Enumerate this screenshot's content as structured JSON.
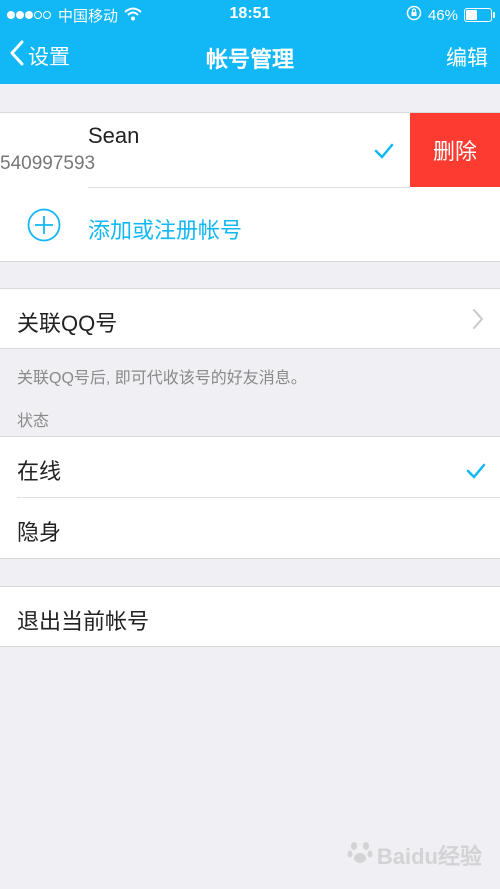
{
  "status_bar": {
    "carrier": "中国移动",
    "time": "18:51",
    "battery": "46%",
    "battery_level": 0.46
  },
  "nav": {
    "back_label": "设置",
    "title": "帐号管理",
    "edit_label": "编辑"
  },
  "account": {
    "name": "Sean",
    "id": "540997593",
    "delete_label": "删除"
  },
  "add_account_label": "添加或注册帐号",
  "linked_qq": {
    "label": "关联QQ号",
    "hint": "关联QQ号后, 即可代收该号的好友消息。"
  },
  "status_section": {
    "header": "状态",
    "options": [
      "在线",
      "隐身"
    ],
    "selected": "在线"
  },
  "logout_label": "退出当前帐号",
  "watermark": "Baidu经验",
  "colors": {
    "accent": "#12b7f5",
    "delete": "#fe3b30",
    "background": "#efeff4"
  }
}
